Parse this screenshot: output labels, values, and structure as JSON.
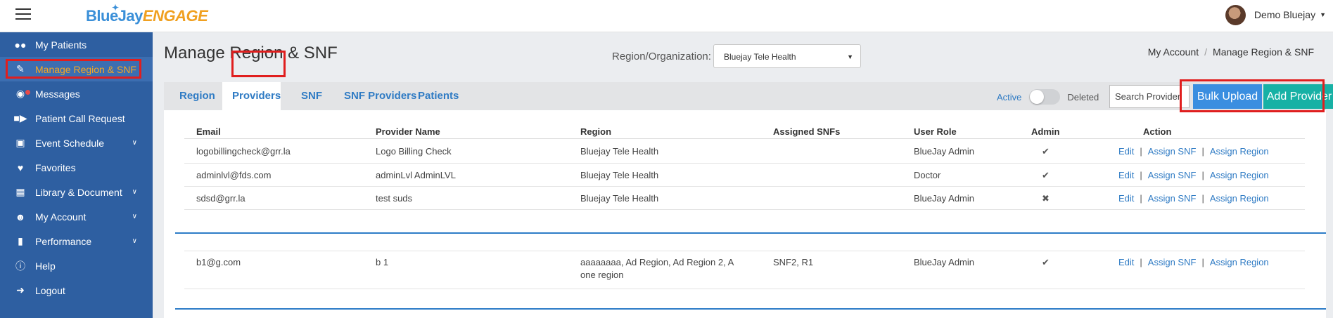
{
  "app": {
    "logo_part1": "BlueJay",
    "logo_part2": "ENGAGE",
    "user_name": "Demo Bluejay"
  },
  "sidebar": {
    "items": [
      {
        "label": "My Patients",
        "icon": "users-icon"
      },
      {
        "label": "Manage Region & SNF",
        "icon": "edit-document-icon",
        "active": true
      },
      {
        "label": "Messages",
        "icon": "chat-icon",
        "notification": true
      },
      {
        "label": "Patient Call Request",
        "icon": "video-camera-icon"
      },
      {
        "label": "Event Schedule",
        "icon": "calendar-icon",
        "expandable": true
      },
      {
        "label": "Favorites",
        "icon": "heart-icon"
      },
      {
        "label": "Library & Document",
        "icon": "library-icon",
        "expandable": true
      },
      {
        "label": "My Account",
        "icon": "user-circle-icon",
        "expandable": true
      },
      {
        "label": "Performance",
        "icon": "bar-chart-icon",
        "expandable": true
      },
      {
        "label": "Help",
        "icon": "info-icon"
      },
      {
        "label": "Logout",
        "icon": "logout-icon"
      }
    ]
  },
  "header": {
    "title": "Manage Region & SNF",
    "region_label": "Region/Organization:",
    "region_value": "Bluejay Tele Health",
    "breadcrumb": [
      "My Account",
      "Manage Region & SNF"
    ]
  },
  "tabs": [
    {
      "label": "Region"
    },
    {
      "label": "Providers",
      "active": true
    },
    {
      "label": "SNF"
    },
    {
      "label": "SNF Providers"
    },
    {
      "label": "Patients"
    }
  ],
  "filters": {
    "active_label": "Active",
    "deleted_label": "Deleted",
    "search_placeholder": "Search Provider",
    "bulk_upload_label": "Bulk Upload",
    "add_provider_label": "Add Provider"
  },
  "table": {
    "columns": [
      "Email",
      "Provider Name",
      "Region",
      "Assigned SNFs",
      "User Role",
      "Admin",
      "Action"
    ],
    "action_labels": {
      "edit": "Edit",
      "assign_snf": "Assign SNF",
      "assign_region": "Assign Region",
      "separator": "|"
    },
    "rows": [
      {
        "email": "logobillingcheck@grr.la",
        "name": "Logo Billing Check",
        "region_line1": "Bluejay Tele Health",
        "region_line2": "",
        "snfs": "",
        "role": "BlueJay Admin",
        "admin": "✔"
      },
      {
        "email": "adminlvl@fds.com",
        "name": "adminLvl AdminLVL",
        "region_line1": "Bluejay Tele Health",
        "region_line2": "",
        "snfs": "",
        "role": "Doctor",
        "admin": "✔"
      },
      {
        "email": "sdsd@grr.la",
        "name": "test suds",
        "region_line1": "Bluejay Tele Health",
        "region_line2": "",
        "snfs": "",
        "role": "BlueJay Admin",
        "admin": "✖"
      },
      {
        "email": "b1@g.com",
        "name": "b 1",
        "region_line1": "aaaaaaaa, Ad Region, Ad Region 2, A",
        "region_line2": "one region",
        "snfs": "SNF2, R1",
        "role": "BlueJay Admin",
        "admin": "✔"
      }
    ]
  },
  "colors": {
    "sidebar": "#2e5fa1",
    "accent": "#2f7bc4",
    "active_label": "#f5a623",
    "bulk_button": "#3a8ee0",
    "add_button": "#17b1a5",
    "highlight": "#e01e1e"
  }
}
